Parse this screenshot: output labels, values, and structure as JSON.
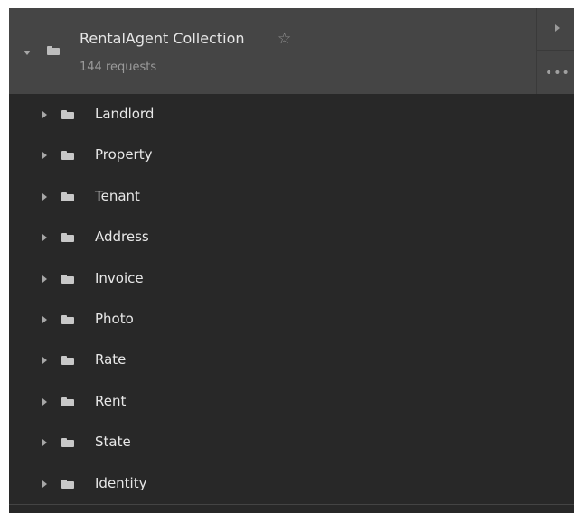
{
  "collection": {
    "name": "RentalAgent Collection",
    "request_count": "144 requests",
    "starred": false
  },
  "folders": [
    {
      "label": "Landlord"
    },
    {
      "label": "Property"
    },
    {
      "label": "Tenant"
    },
    {
      "label": "Address"
    },
    {
      "label": "Invoice"
    },
    {
      "label": "Photo"
    },
    {
      "label": "Rate"
    },
    {
      "label": "Rent"
    },
    {
      "label": "State"
    },
    {
      "label": "Identity"
    }
  ],
  "icons": {
    "collection_toggle": "caret-down-icon",
    "folder": "folder-icon",
    "favorite": "star-outline-icon",
    "run": "play-icon",
    "more": "ellipsis-icon",
    "folder_toggle": "caret-right-icon"
  },
  "colors": {
    "header_bg": "#454545",
    "panel_bg": "#282828",
    "text": "#e6e6e6",
    "muted_text": "#9a9a9a"
  }
}
